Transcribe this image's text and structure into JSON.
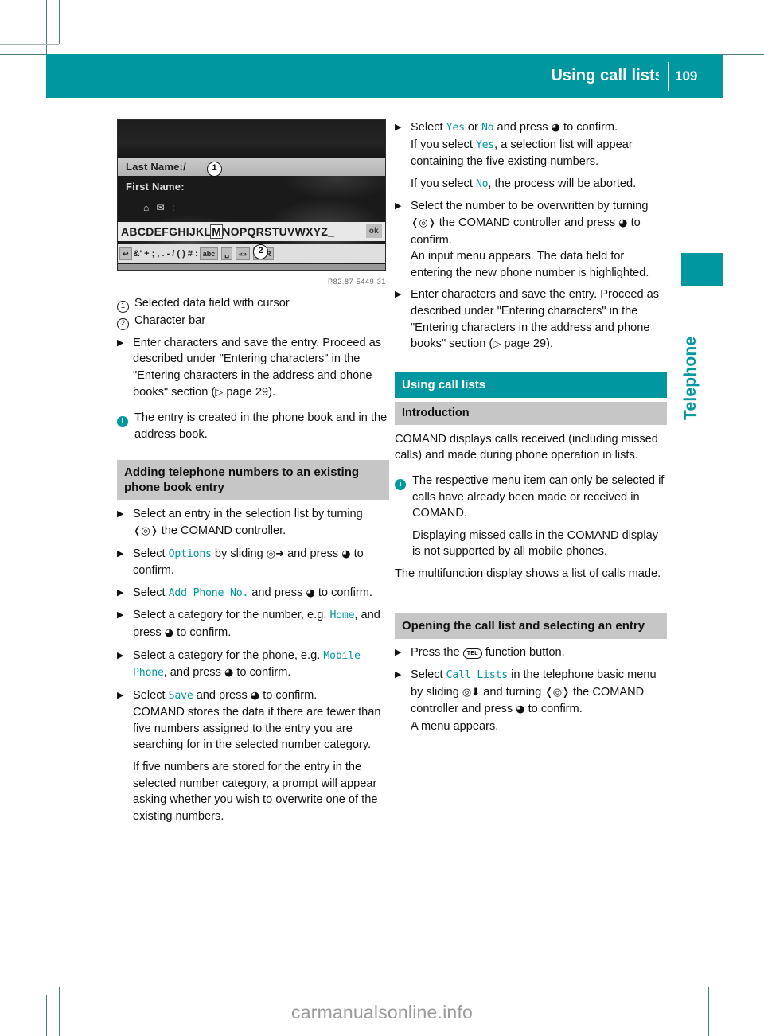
{
  "header": {
    "title": "Using call lists",
    "page_number": "109",
    "accent_color": "#0097a0"
  },
  "side_tab": {
    "label": "Telephone"
  },
  "figure": {
    "code": "P82.87-5449-31",
    "screen": {
      "field_1_label": "Last Name:/",
      "field_2_label": "First Name:",
      "icon_row": "⌂ ✉ :",
      "character_bar": "ABCDEFGHIJKL",
      "character_bar_highlight": "M",
      "character_bar_rest": "NOPQRSTUVWXYZ_",
      "ok_key": "ok",
      "symbol_bar": "&' + ; , . - / ( ) # :",
      "symbol_keys": [
        "abc",
        "␣",
        "«»",
        "CLR"
      ],
      "back_key": "↩"
    },
    "callouts": [
      {
        "number": "1"
      },
      {
        "number": "2"
      }
    ]
  },
  "left_column": {
    "legend": [
      {
        "number": "1",
        "text": "Selected data field with cursor"
      },
      {
        "number": "2",
        "text": "Character bar"
      }
    ],
    "step_enter_characters": {
      "line1": "Enter characters and save the entry.",
      "line2": "Proceed as described under \"Entering characters\" in the \"Entering characters in the address and phone books\" section",
      "page_ref_open": "(",
      "page_ref_arrow": "▷",
      "page_ref_text": " page 29).",
      "page_ref_number": "29"
    },
    "note_entry_created": "The entry is created in the phone book and in the address book.",
    "heading_adding": "Adding telephone numbers to an existing phone book entry",
    "steps": [
      {
        "pre": "Select an entry in the selection list by turning ",
        "glyph": "turn",
        "post": " the COMAND controller."
      },
      {
        "pre": "Select ",
        "ui": "Options",
        "mid": " by sliding ",
        "glyph": "slide-right",
        "mid2": " and press ",
        "glyph2": "press",
        "post": " to confirm."
      },
      {
        "pre": "Select ",
        "ui": "Add Phone No.",
        "mid": " and press ",
        "glyph": "press",
        "post": " to confirm."
      },
      {
        "pre": "Select a category for the number, e.g. ",
        "ui": "Home",
        "mid": ", and press ",
        "glyph": "press",
        "post": " to confirm."
      },
      {
        "pre": "Select a category for the phone, e.g. ",
        "ui": "Mobile Phone",
        "mid": ", and press ",
        "glyph": "press",
        "post": " to confirm."
      },
      {
        "pre": "Select ",
        "ui": "Save",
        "mid": " and press ",
        "glyph": "press",
        "post": " to confirm."
      }
    ],
    "para_stores": "COMAND stores the data if there are fewer than five numbers assigned to the entry you are searching for in the selected number category.",
    "para_five": "If five numbers are stored for the entry in the selected number category, a prompt will appear asking whether you wish to overwrite one of the existing numbers."
  },
  "right_column": {
    "step_yes_no": {
      "pre": "Select ",
      "ui_yes": "Yes",
      "mid": " or ",
      "ui_no": "No",
      "post": " and press ",
      "post2": " to confirm."
    },
    "para_yes": {
      "pre": "If you select ",
      "ui": "Yes",
      "post": ", a selection list will appear containing the five existing numbers."
    },
    "para_no": {
      "pre": "If you select ",
      "ui": "No",
      "post": ", the process will be aborted."
    },
    "step_overwrite": {
      "line1_pre": "Select the number to be overwritten by turning ",
      "line1_post": " the COMAND controller and press ",
      "line1_end": " to confirm.",
      "line2": "An input menu appears. The data field for entering the new phone number is highlighted."
    },
    "step_enter_characters": {
      "line1": "Enter characters and save the entry.",
      "line2": "Proceed as described under \"Entering characters\" in the \"Entering characters in the address and phone books\" section",
      "page_ref_arrow": "▷",
      "page_ref_text": " page 29).",
      "page_ref_number": "29"
    },
    "heading_using_call_lists": "Using call lists",
    "heading_introduction": "Introduction",
    "para_intro": "COMAND displays calls received (including missed calls) and made during phone operation in lists.",
    "note_respective": "The respective menu item can only be selected if calls have already been made or received in COMAND.",
    "note_displaying": "Displaying missed calls in the COMAND display is not supported by all mobile phones.",
    "para_multifunction": "The multifunction display shows a list of calls made.",
    "heading_opening": "Opening the call list and selecting an entry",
    "step_press_tel": {
      "pre": "Press the ",
      "button": "TEL",
      "post": " function button."
    },
    "step_call_lists": {
      "pre": "Select ",
      "ui": "Call Lists",
      "mid": " in the telephone basic menu by sliding ",
      "mid2": " and turning ",
      "mid3": " the COMAND controller and press ",
      "post": " to confirm.",
      "line2": "A menu appears."
    }
  },
  "watermark": "carmanualsonline.info"
}
